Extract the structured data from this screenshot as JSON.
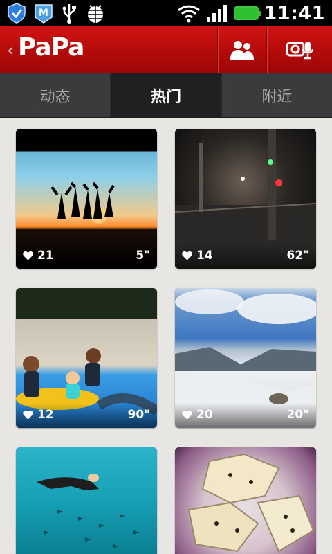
{
  "status_bar": {
    "time": "11:41",
    "icons": [
      "shield-icon",
      "maxthon-m-icon",
      "usb-icon",
      "android-debug-icon",
      "wifi-icon",
      "signal-icon",
      "battery-icon"
    ]
  },
  "header": {
    "logo": "PaPa",
    "back_icon": "chevron-left-icon",
    "friends_icon": "users-icon",
    "record_icon": "camera-mic-icon"
  },
  "tabs": [
    {
      "label": "动态",
      "active": false
    },
    {
      "label": "热门",
      "active": true
    },
    {
      "label": "附近",
      "active": false
    }
  ],
  "posts": [
    {
      "likes": "21",
      "duration": "5\"",
      "scene": "sunset-silhouettes"
    },
    {
      "likes": "14",
      "duration": "62\"",
      "scene": "night-street"
    },
    {
      "likes": "12",
      "duration": "90\"",
      "scene": "kids-dolphin-pool"
    },
    {
      "likes": "20",
      "duration": "20\"",
      "scene": "snowy-mountains"
    },
    {
      "likes": "",
      "duration": "",
      "scene": "snorkeling"
    },
    {
      "likes": "",
      "duration": "",
      "scene": "cookies"
    }
  ],
  "colors": {
    "header_red": "#c40f0f",
    "tab_bg": "#3a3b3d",
    "tab_active_bg": "#1f2022",
    "page_bg": "#e8e6e3",
    "battery_green": "#2fc02f"
  }
}
